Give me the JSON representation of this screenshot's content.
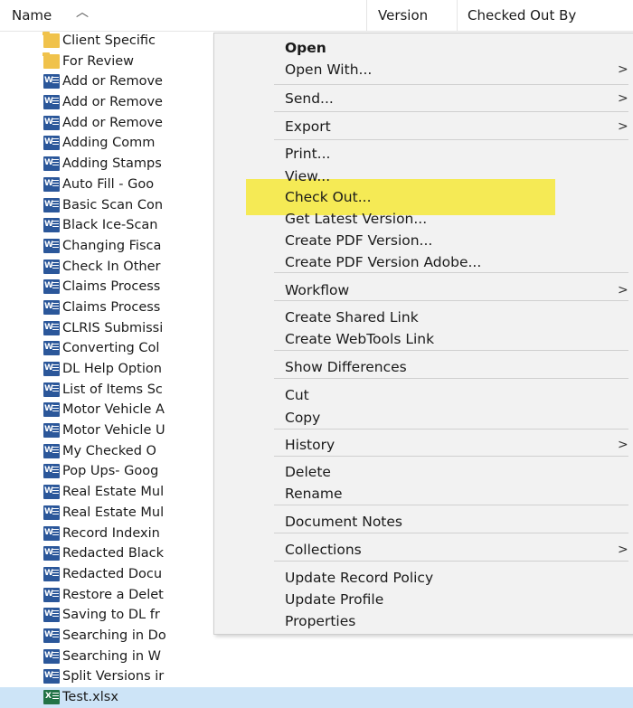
{
  "header": {
    "name": "Name",
    "version": "Version",
    "checked_out_by": "Checked Out By"
  },
  "files": [
    {
      "name": "Client Specific",
      "type": "folder"
    },
    {
      "name": "For Review",
      "type": "folder"
    },
    {
      "name": "Add or Remove",
      "type": "word"
    },
    {
      "name": "Add or Remove",
      "type": "word"
    },
    {
      "name": "Add or Remove",
      "type": "word"
    },
    {
      "name": "Adding Comm",
      "type": "word"
    },
    {
      "name": "Adding Stamps",
      "type": "word"
    },
    {
      "name": "Auto Fill - Goo",
      "type": "word"
    },
    {
      "name": "Basic Scan Con",
      "type": "word"
    },
    {
      "name": "Black Ice-Scan",
      "type": "word"
    },
    {
      "name": "Changing Fisca",
      "type": "word"
    },
    {
      "name": "Check In Other",
      "type": "word"
    },
    {
      "name": "Claims Process",
      "type": "word"
    },
    {
      "name": "Claims Process",
      "type": "word"
    },
    {
      "name": "CLRIS Submissi",
      "type": "word"
    },
    {
      "name": "Converting Col",
      "type": "word"
    },
    {
      "name": "DL Help Option",
      "type": "word"
    },
    {
      "name": "List of Items Sc",
      "type": "word"
    },
    {
      "name": "Motor Vehicle A",
      "type": "word"
    },
    {
      "name": "Motor Vehicle U",
      "type": "word"
    },
    {
      "name": "My Checked O",
      "type": "word"
    },
    {
      "name": "Pop Ups- Goog",
      "type": "word"
    },
    {
      "name": "Real Estate Mul",
      "type": "word"
    },
    {
      "name": "Real Estate Mul",
      "type": "word"
    },
    {
      "name": "Record Indexin",
      "type": "word"
    },
    {
      "name": "Redacted Black",
      "type": "word"
    },
    {
      "name": "Redacted Docu",
      "type": "word"
    },
    {
      "name": "Restore a Delet",
      "type": "word"
    },
    {
      "name": "Saving to DL fr",
      "type": "word"
    },
    {
      "name": "Searching in Do",
      "type": "word"
    },
    {
      "name": "Searching in W",
      "type": "word"
    },
    {
      "name": "Split Versions ir",
      "type": "word"
    },
    {
      "name": "Test.xlsx",
      "type": "excel",
      "selected": true
    }
  ],
  "menu": {
    "highlighted": "Check Out...",
    "highlight_color": "#f5ea55",
    "items": [
      {
        "label": "Open",
        "bold": true,
        "submenu": false
      },
      {
        "label": "Open With...",
        "submenu": true
      },
      {
        "label": "Send...",
        "submenu": true
      },
      {
        "label": "Export",
        "submenu": true
      },
      {
        "label": "Print...",
        "submenu": false
      },
      {
        "label": "View...",
        "submenu": false
      },
      {
        "label": "Check Out...",
        "submenu": false
      },
      {
        "label": "Get Latest Version...",
        "submenu": false
      },
      {
        "label": "Create PDF Version...",
        "submenu": false
      },
      {
        "label": "Create PDF Version Adobe...",
        "submenu": false
      },
      {
        "label": "Workflow",
        "submenu": true
      },
      {
        "label": "Create Shared Link",
        "submenu": false
      },
      {
        "label": "Create WebTools Link",
        "submenu": false
      },
      {
        "label": "Show Differences",
        "submenu": false
      },
      {
        "label": "Cut",
        "submenu": false
      },
      {
        "label": "Copy",
        "submenu": false
      },
      {
        "label": "History",
        "submenu": true
      },
      {
        "label": "Delete",
        "submenu": false
      },
      {
        "label": "Rename",
        "submenu": false
      },
      {
        "label": "Document Notes",
        "submenu": false
      },
      {
        "label": "Collections",
        "submenu": true
      },
      {
        "label": "Update Record Policy",
        "submenu": false
      },
      {
        "label": "Update Profile",
        "submenu": false
      },
      {
        "label": "Properties",
        "submenu": false
      }
    ],
    "submenu_glyph": ">"
  }
}
